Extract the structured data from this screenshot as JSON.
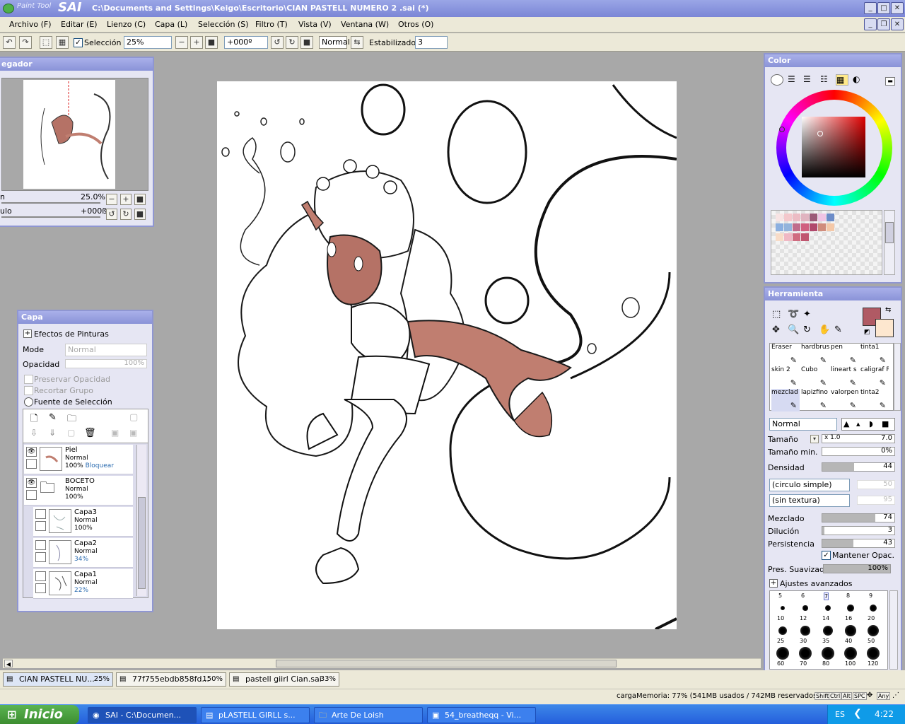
{
  "window": {
    "title": "C:\\Documents and Settings\\Keigo\\Escritorio\\CIAN PASTELL NUMERO 2 .sai (*)",
    "brand_small": "Paint Tool",
    "brand_big": "SAI"
  },
  "menu": [
    "Archivo (F)",
    "Editar (E)",
    "Lienzo (C)",
    "Capa (L)",
    "Selección (S)",
    "Filtro (T)",
    "Vista (V)",
    "Ventana (W)",
    "Otros (O)"
  ],
  "toolbar": {
    "selection_label": "Selección",
    "zoom": "25%",
    "rotation": "+000º",
    "blend": "Normal",
    "stabilizer_label": "Estabilizador",
    "stabilizer_value": "3"
  },
  "navigator": {
    "title": "egador",
    "zoom_label": "n",
    "zoom_value": "25.0%",
    "angle_label": "ulo",
    "angle_value": "+000ß"
  },
  "layers_panel": {
    "title": "Capa",
    "effects": "Efectos de Pinturas",
    "mode_label": "Mode",
    "mode_value": "Normal",
    "opacity_label": "Opacidad",
    "opacity_value": "100%",
    "preserve_opacity": "Preservar Opacidad",
    "clip_group": "Recortar Grupo",
    "selection_source": "Fuente de Selección",
    "layers": [
      {
        "name": "Piel",
        "mode": "Normal",
        "opacity": "100%",
        "extra": "Bloquear"
      },
      {
        "name": "BOCETO",
        "mode": "Normal",
        "opacity": "100%",
        "extra": ""
      },
      {
        "name": "Capa3",
        "mode": "Normal",
        "opacity": "100%",
        "extra": ""
      },
      {
        "name": "Capa2",
        "mode": "Normal",
        "opacity": "34%",
        "extra": ""
      },
      {
        "name": "Capa1",
        "mode": "Normal",
        "opacity": "22%",
        "extra": ""
      }
    ]
  },
  "color_panel": {
    "title": "Color",
    "main_color": "#b05a64",
    "swatches": [
      "#f8e4e4",
      "#f4c8cc",
      "#ecbcc4",
      "#e0b4c0",
      "#9c5a78",
      "#f0c4e4",
      "#6c8cc8",
      "#8cb0e0",
      "#94b4dc",
      "#c06c8c",
      "#d06080",
      "#b0486c",
      "#d08c7c",
      "#f4c8a8",
      "#f8dcc8",
      "#f0b8c4",
      "#d06c80",
      "#c05670"
    ]
  },
  "tool_panel": {
    "title": "Herramienta",
    "primary_color": "#b05a64",
    "secondary_color": "#fde7cf",
    "brushes": [
      [
        "Eraser",
        "hardbrus",
        "pen",
        "tinta1"
      ],
      [
        "skin 2",
        "Cubo",
        "lineart s",
        "caligraf Pen"
      ],
      [
        "mezclad",
        "lapizfino",
        "valorpen",
        "tinta2"
      ]
    ],
    "blend_mode": "Normal",
    "size_label": "Tamaño",
    "size_mult": "x 1.0",
    "size_value": "7.0",
    "min_size_label": "Tamaño min.",
    "min_size_value": "0%",
    "density_label": "Densidad",
    "density_value": "44",
    "density": 0.44,
    "shape": "(circulo simple)",
    "shape_value": "50",
    "texture": "(sin textura)",
    "texture_value": "95",
    "blending_label": "Mezclado",
    "blending_value": "74",
    "blending": 0.74,
    "dilution_label": "Dilución",
    "dilution_value": "3",
    "dilution": 0.03,
    "persistence_label": "Persistencia",
    "persistence_value": "43",
    "persistence": 0.43,
    "keep_opacity": "Mantener Opac.",
    "smoothing_label": "Pres. Suavizado",
    "smoothing_value": "100%",
    "advanced": "Ajustes avanzados",
    "sizes_top": [
      "5",
      "6",
      "7",
      "8",
      "9"
    ],
    "sizes": [
      "10",
      "12",
      "14",
      "16",
      "20",
      "25",
      "30",
      "35",
      "40",
      "50",
      "60",
      "70",
      "80",
      "100",
      "120"
    ]
  },
  "doc_tabs": [
    {
      "name": "CIAN PASTELL NU...",
      "zoom": "25%"
    },
    {
      "name": "77f755ebdb858fd...",
      "zoom": "150%"
    },
    {
      "name": "pastell giirl Cian.sai",
      "zoom": "33%"
    }
  ],
  "status": {
    "memory": "cargaMemoria: 77% (541MB usados / 742MB reservados)",
    "keys": [
      "Shift",
      "Ctrl",
      "Alt",
      "SPC",
      "Any"
    ]
  },
  "taskbar": {
    "start": "Inicio",
    "tasks": [
      "SAI - C:\\Documen...",
      "pLASTELL GIRLL s...",
      "Arte De Loish",
      "54_breatheqq - Vi..."
    ],
    "lang": "ES",
    "time": "4:22"
  }
}
